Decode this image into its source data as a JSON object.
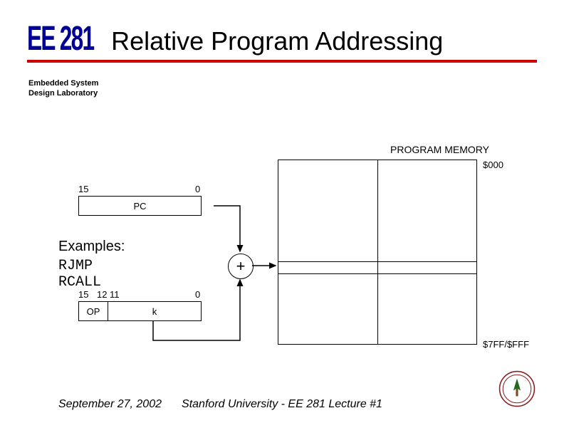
{
  "header": {
    "course_code": "EE 281",
    "title": "Relative Program Addressing",
    "lab_line1": "Embedded System",
    "lab_line2": "Design Laboratory"
  },
  "examples": {
    "heading": "Examples:",
    "line1": "RJMP",
    "line2": "RCALL"
  },
  "diagram": {
    "prog_mem_label": "PROGRAM MEMORY",
    "addr_top": "$000",
    "addr_bot": "$7FF/$FFF",
    "pc_label": "PC",
    "pc_hi": "15",
    "pc_lo": "0",
    "op_label": "OP",
    "k_label": "k",
    "k_hi": "15",
    "k_mid_hi": "12",
    "k_mid_lo": "11",
    "k_lo": "0",
    "adder": "+"
  },
  "footer": {
    "date": "September 27, 2002",
    "center": "Stanford University - EE 281 Lecture #1"
  }
}
